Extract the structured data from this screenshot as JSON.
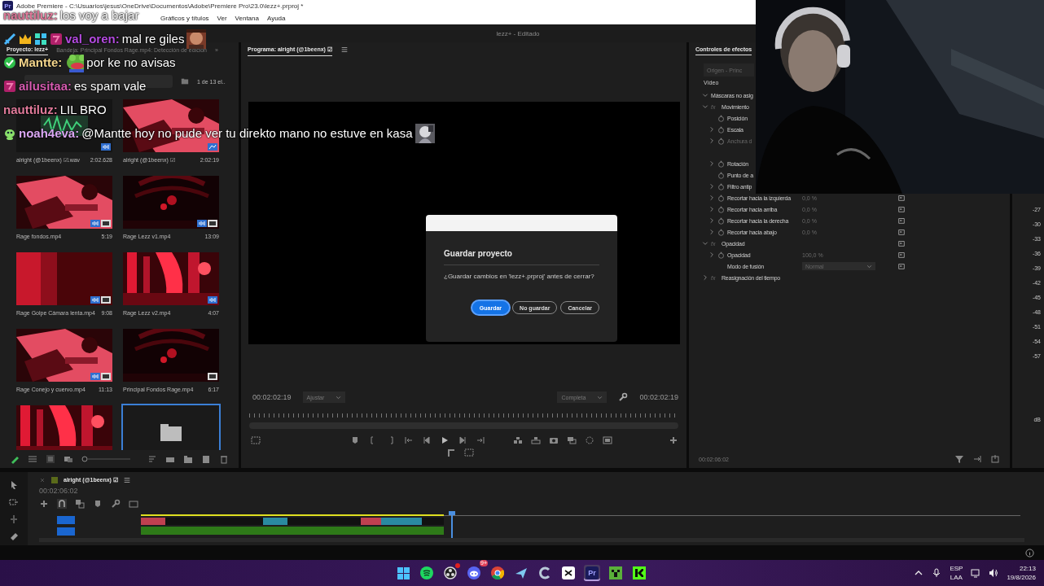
{
  "window": {
    "app_icon": "Pr",
    "title": "Adobe Premiere - C:\\Usuarios\\jesus\\OneDrive\\Documentos\\Adobe\\Premiere Pro\\23.0\\lezz+.prproj *"
  },
  "menu": [
    "Gráficos y títulos",
    "Ver",
    "Ventana",
    "Ayuda"
  ],
  "workspace": {
    "title": "lezz+ - Editado"
  },
  "project": {
    "tabs": [
      {
        "label": "Proyecto: lezz+",
        "selected": true
      },
      {
        "label": "Bandeja: Principal Fondos Rage.mp4: Detección de edición",
        "selected": false
      }
    ],
    "overflow": "»",
    "count": "1 de 13 el..",
    "items": [
      {
        "kind": "audio",
        "name": "alright (@1beenx) ☑.wav",
        "duration": "2:02.628",
        "badges": [
          {
            "kind": "audio"
          }
        ],
        "selected": false
      },
      {
        "kind": "sequence",
        "name": "alright (@1beenx) ☑",
        "duration": "2:02:19",
        "badges": [
          {
            "kind": "sequence"
          }
        ],
        "selected": false
      },
      {
        "kind": "video",
        "name": "Rage fondos.mp4",
        "duration": "5:19",
        "badges": [
          {
            "kind": "audio"
          },
          {
            "kind": "video"
          }
        ],
        "selected": false
      },
      {
        "kind": "video",
        "name": "Rage Lezz v1.mp4",
        "duration": "13:09",
        "badges": [
          {
            "kind": "audio"
          },
          {
            "kind": "video"
          }
        ],
        "selected": false
      },
      {
        "kind": "video",
        "name": "Rage Golpe Cámara lenta.mp4",
        "duration": "9:08",
        "badges": [
          {
            "kind": "audio"
          },
          {
            "kind": "video"
          }
        ],
        "selected": false
      },
      {
        "kind": "video",
        "name": "Rage Lezz v2.mp4",
        "duration": "4:07",
        "badges": [
          {
            "kind": "audio"
          }
        ],
        "selected": false
      },
      {
        "kind": "video",
        "name": "Rage Conejo y cuervo.mp4",
        "duration": "11:13",
        "badges": [
          {
            "kind": "audio"
          },
          {
            "kind": "video"
          }
        ],
        "selected": false
      },
      {
        "kind": "video",
        "name": "Principal Fondos Rage.mp4",
        "duration": "6:17",
        "badges": [
          {
            "kind": "video"
          }
        ],
        "selected": false
      },
      {
        "kind": "video",
        "selected": false
      },
      {
        "kind": "folder",
        "selected": true
      }
    ]
  },
  "monitor": {
    "title": "Programa: alright (@1beenx) ☑",
    "timecode_left": "00:02:02:19",
    "zoom": "Ajustar",
    "quality": "Completa",
    "timecode_right": "00:02:02:19"
  },
  "dialog": {
    "title": "Guardar proyecto",
    "message": "¿Guardar cambios en 'lezz+.prproj' antes de cerrar?",
    "buttons": [
      {
        "label": "Guardar",
        "kind": "primary"
      },
      {
        "label": "No guardar",
        "kind": "secondary"
      },
      {
        "label": "Cancelar",
        "kind": "secondary"
      }
    ]
  },
  "effects": {
    "tab": "Controles de efectos",
    "source": "Origen - Princ",
    "section": "Vídeo",
    "timecode": "00:02:06:02",
    "groups": [
      {
        "label": "Máscaras no asig",
        "expanded": true
      },
      {
        "fx": "fx",
        "label": "Movimiento",
        "expanded": true,
        "children": [
          {
            "kind": "param",
            "label": "Posición"
          },
          {
            "kind": "param",
            "label": "Escala",
            "expandable": true
          },
          {
            "kind": "param",
            "label": "Anchura d",
            "expandable": true,
            "disabled": true
          },
          {
            "kind": "param",
            "label": "Rotación",
            "expandable": true
          },
          {
            "kind": "param",
            "label": "Punto de a"
          },
          {
            "kind": "param",
            "label": "Filtro antip",
            "expandable": true
          },
          {
            "kind": "param",
            "label": "Recortar hacia la izquierda",
            "value": "0,0 %",
            "expandable": true,
            "reset": true
          },
          {
            "kind": "param",
            "label": "Recortar hacia arriba",
            "value": "0,0 %",
            "expandable": true,
            "reset": true
          },
          {
            "kind": "param",
            "label": "Recortar hacia la derecha",
            "value": "0,0 %",
            "expandable": true,
            "reset": true
          },
          {
            "kind": "param",
            "label": "Recortar hacia abajo",
            "value": "0,0 %",
            "expandable": true,
            "reset": true
          }
        ]
      },
      {
        "fx": "fx",
        "label": "Opacidad",
        "expanded": true,
        "reset": true,
        "children": [
          {
            "kind": "param",
            "label": "Opacidad",
            "value": "100,0 %",
            "expandable": true,
            "reset": true
          },
          {
            "kind": "dropdown",
            "label": "Modo de fusión",
            "value": "Normal",
            "reset": true
          }
        ]
      },
      {
        "fx": "fx",
        "label": "Reasignación del tiempo",
        "expanded": false
      }
    ]
  },
  "meter": {
    "labels": [
      "-27",
      "-30",
      "-33",
      "-36",
      "-39",
      "-42",
      "-45",
      "-48",
      "-51",
      "-54",
      "-57"
    ],
    "unit": "dB"
  },
  "timeline": {
    "sequence": "alright (@1beenx) ☑",
    "timecode": "00:02:06:02"
  },
  "taskbar": {
    "apps": [
      {
        "kind": "start",
        "active": false
      },
      {
        "kind": "spotify",
        "active": false
      },
      {
        "kind": "obs",
        "active": false,
        "dot": true
      },
      {
        "kind": "discord",
        "active": false,
        "badge": "9+"
      },
      {
        "kind": "chrome",
        "active": false
      },
      {
        "kind": "plane",
        "active": false
      },
      {
        "kind": "ccleaner",
        "active": false
      },
      {
        "kind": "capcut",
        "active": false
      },
      {
        "kind": "premiere",
        "label": "Pr",
        "active": true
      },
      {
        "kind": "creeper",
        "active": false
      },
      {
        "kind": "kick",
        "active": false
      }
    ],
    "language": [
      "ESP",
      "LAA"
    ],
    "time": "22:13",
    "date": "19/8/2026"
  },
  "chat": [
    {
      "user": "nauttiluz:",
      "color": "#e07a9a",
      "message": "los voy a bajar"
    },
    {
      "user": "val_oren:",
      "color": "#b44be0",
      "message": "mal re giles",
      "badges": [
        {
          "kind": "sword"
        },
        {
          "kind": "crown"
        },
        {
          "kind": "gg"
        },
        {
          "kind": "seventv"
        }
      ],
      "emote_after": true
    },
    {
      "user": "Mantte:",
      "color": "#f5d68c",
      "message": "por ke no avisas",
      "badges": [
        {
          "kind": "verified"
        }
      ],
      "emote_before": true
    },
    {
      "user": "ailusitaa:",
      "color": "#d65bb0",
      "message": "es spam vale",
      "badges": [
        {
          "kind": "seventv"
        }
      ]
    },
    {
      "user": "nauttiluz:",
      "color": "#e07a9a",
      "message": "LIL BRO"
    },
    {
      "user": "noah4eva:",
      "color": "#d9a6f2",
      "message": "@Mantte hoy no pude ver tu direkto mano no estuve en kasa",
      "badges": [
        {
          "kind": "alien"
        }
      ],
      "emote_after": true
    }
  ]
}
